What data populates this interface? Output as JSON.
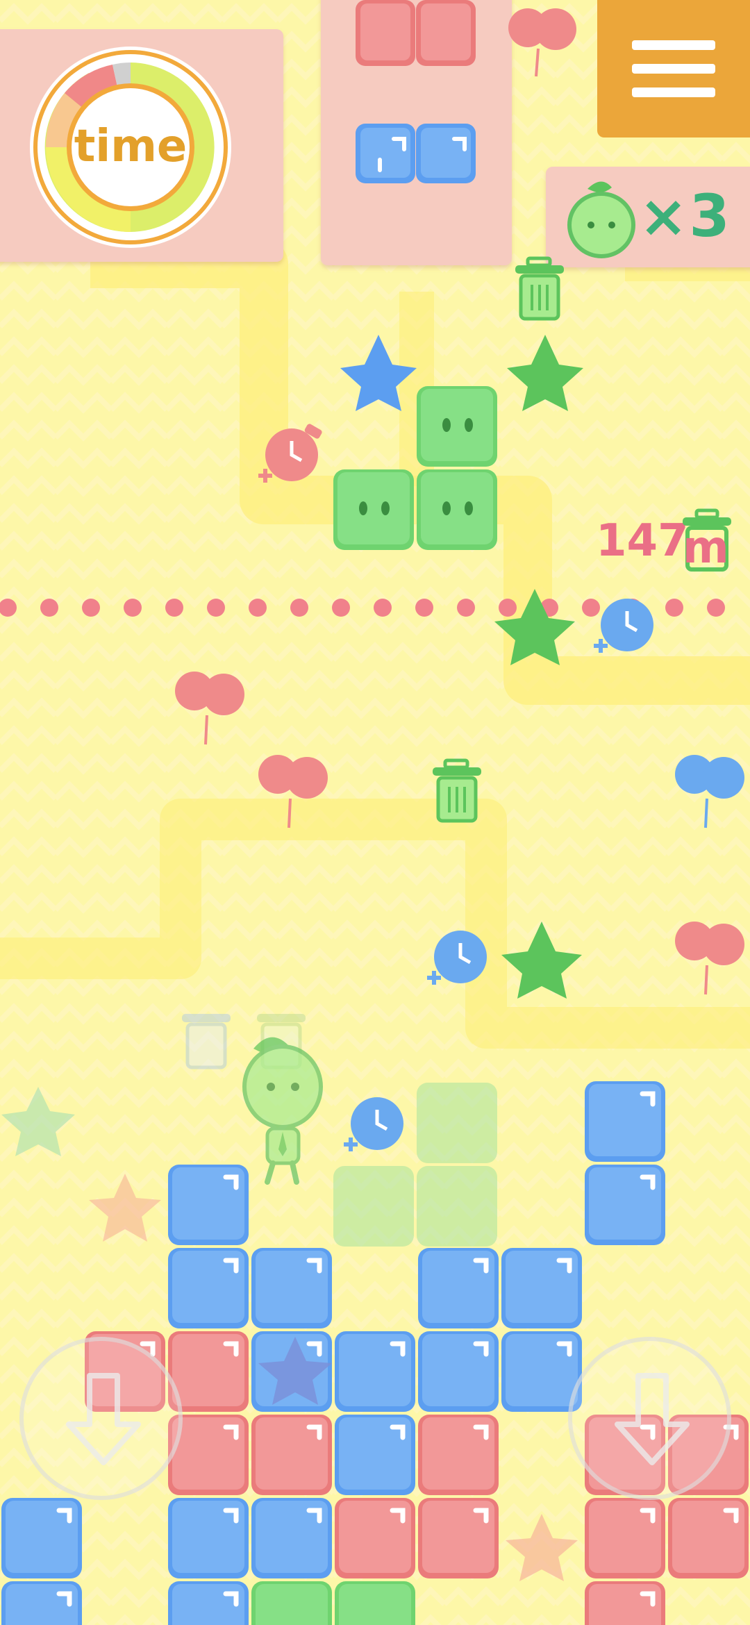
{
  "timer": {
    "label": "time"
  },
  "menu": {
    "icon": "hamburger-menu-icon"
  },
  "lives": {
    "icon": "green-sprout-blob-icon",
    "text": "×3"
  },
  "distance": {
    "value": "147",
    "unit": "m"
  },
  "controls": {
    "left": "down-arrow-left-button",
    "right": "down-arrow-right-button"
  },
  "colors": {
    "background": "#fdf7a8",
    "panel": "#f6cbc0",
    "menu": "#eba63a",
    "block_red": "#ef8f8f",
    "block_blue": "#6aa9ef",
    "block_green": "#7fdd7f",
    "text_pink": "#ea6f86",
    "text_green": "#3db07a"
  }
}
